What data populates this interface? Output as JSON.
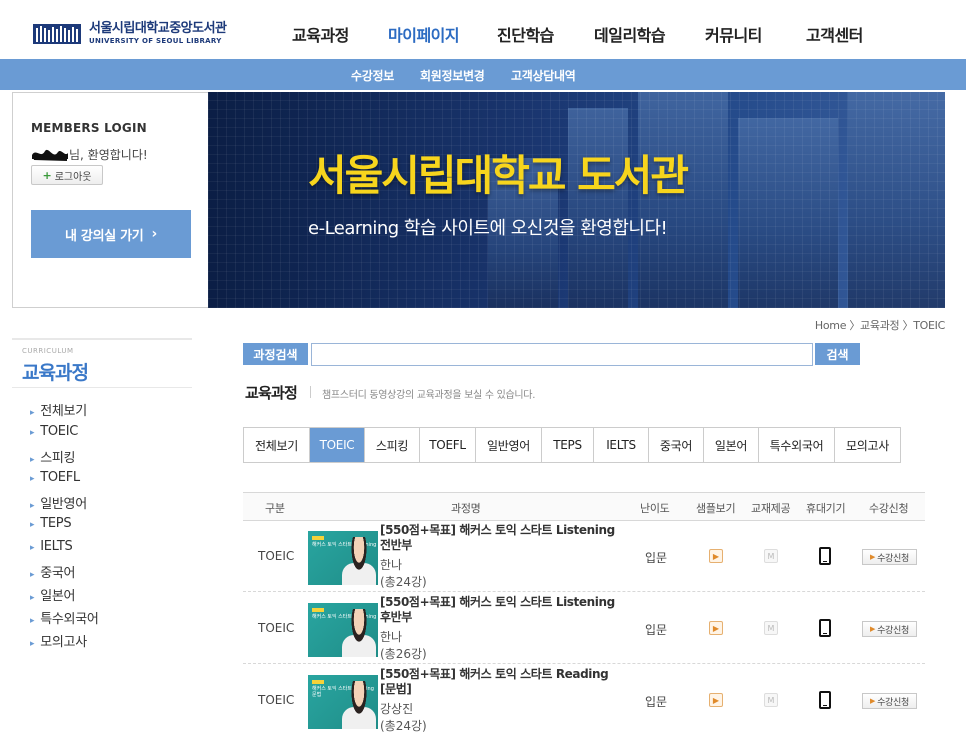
{
  "header": {
    "logo_kr": "서울시립대학교중앙도서관",
    "logo_en": "UNIVERSITY OF SEOUL LIBRARY",
    "menu": [
      {
        "label": "교육과정",
        "active": false
      },
      {
        "label": "마이페이지",
        "active": true
      },
      {
        "label": "진단학습",
        "active": false
      },
      {
        "label": "데일리학습",
        "active": false
      },
      {
        "label": "커뮤니티",
        "active": false
      },
      {
        "label": "고객센터",
        "active": false
      }
    ]
  },
  "subnav": [
    "수강정보",
    "회원정보변경",
    "고객상담내역"
  ],
  "login": {
    "title": "MEMBERS LOGIN",
    "welcome": "님, 환영합니다!",
    "logout": "로그아웃",
    "myroom": "내 강의실 가기"
  },
  "banner": {
    "title": "서울시립대학교 도서관",
    "subtitle": "e-Learning 학습 사이트에 오신것을 환영합니다!"
  },
  "breadcrumb": "Home 〉교육과정 〉TOEIC",
  "lnb": {
    "small": "CURRICULUM",
    "title": "교육과정",
    "items": [
      "전체보기",
      "TOEIC",
      "스피킹",
      "TOEFL",
      "일반영어",
      "TEPS",
      "IELTS",
      "중국어",
      "일본어",
      "특수외국어",
      "모의고사"
    ]
  },
  "search": {
    "label": "과정검색",
    "value": "",
    "button": "검색"
  },
  "section": {
    "title": "교육과정",
    "desc": "챔프스터디 동영상강의 교육과정을 보실 수 있습니다."
  },
  "tabs": [
    {
      "label": "전체보기",
      "active": false
    },
    {
      "label": "TOEIC",
      "active": true
    },
    {
      "label": "스피킹",
      "active": false
    },
    {
      "label": "TOEFL",
      "active": false
    },
    {
      "label": "일반영어",
      "active": false
    },
    {
      "label": "TEPS",
      "active": false
    },
    {
      "label": "IELTS",
      "active": false
    },
    {
      "label": "중국어",
      "active": false
    },
    {
      "label": "일본어",
      "active": false
    },
    {
      "label": "특수외국어",
      "active": false
    },
    {
      "label": "모의고사",
      "active": false
    }
  ],
  "table": {
    "headers": [
      "구분",
      "과정명",
      "난이도",
      "샘플보기",
      "교재제공",
      "휴대기기",
      "수강신청"
    ],
    "rows": [
      {
        "type": "TOEIC",
        "title": "[550점+목표] 해커스 토익 스타트 Listening 전반부",
        "teacher": "한나",
        "count": "(총24강)",
        "level": "입문",
        "thumb_text": "해커스 토익 스타트 Listening",
        "apply": "수강신청"
      },
      {
        "type": "TOEIC",
        "title": "[550점+목표] 해커스 토익 스타트 Listening 후반부",
        "teacher": "한나",
        "count": "(총26강)",
        "level": "입문",
        "thumb_text": "해커스 토익 스타트 Listening",
        "apply": "수강신청"
      },
      {
        "type": "TOEIC",
        "title": "[550점+목표] 해커스 토익 스타트 Reading [문법]",
        "teacher": "강상진",
        "count": "(총24강)",
        "level": "입문",
        "thumb_text": "해커스 토익 스타트 Reading 문법",
        "apply": "수강신청"
      }
    ]
  },
  "colors": {
    "accent": "#6a9bd4",
    "active_menu": "#2c6bc2",
    "banner_title": "#f7d51d"
  }
}
